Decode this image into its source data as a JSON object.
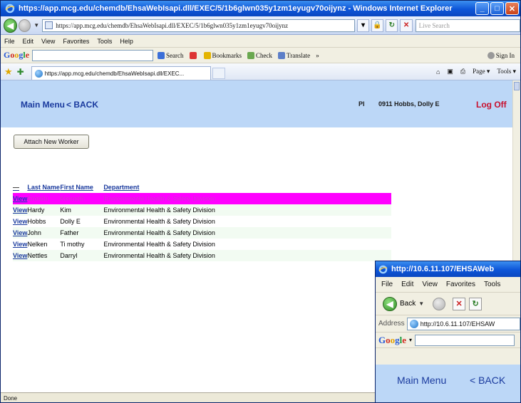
{
  "browser": {
    "title": "https://app.mcg.edu/chemdb/EhsaWebIsapi.dll/EXEC/5/1b6glwn035y1zm1eyugv70oijynz - Windows Internet Explorer",
    "url": "https://app.mcg.edu/chemdb/EhsaWebIsapi.dll/EXEC/5/1b6glwn035y1zm1eyugv70oijynz",
    "live_search_placeholder": "Live Search",
    "menu": [
      "File",
      "Edit",
      "View",
      "Favorites",
      "Tools",
      "Help"
    ],
    "google_toolbar": {
      "search": "Search",
      "bookmarks": "Bookmarks",
      "check": "Check",
      "translate": "Translate",
      "sign_in": "Sign In"
    },
    "tab_title": "https://app.mcg.edu/chemdb/EhsaWebIsapi.dll/EXEC...",
    "command_bar": {
      "page": "Page",
      "tools": "Tools"
    },
    "status": "Done"
  },
  "app": {
    "main_menu": "Main Menu",
    "back": "< BACK",
    "role": "PI",
    "user": "0911  Hobbs, Dolly E",
    "log_off": "Log Off",
    "attach_button": "Attach New Worker",
    "table": {
      "dash": "—",
      "headers": [
        "Last Name",
        "First Name",
        "Department"
      ],
      "view_label": "View",
      "rows": [
        {
          "last": "Erondu",
          "first": "Kenneth",
          "dept": "Environmental Health & Safety Division"
        },
        {
          "last": "Hardy",
          "first": "Kim",
          "dept": "Environmental Health & Safety Division"
        },
        {
          "last": "Hobbs",
          "first": "Dolly E",
          "dept": "Environmental Health & Safety Division"
        },
        {
          "last": "John",
          "first": "Father",
          "dept": "Environmental Health & Safety Division"
        },
        {
          "last": "Nelken",
          "first": "Ti mothy",
          "dept": "Environmental Health & Safety Division"
        },
        {
          "last": "Nettles",
          "first": "Darryl",
          "dept": "Environmental Health & Safety Division"
        }
      ]
    }
  },
  "second_window": {
    "title": "http://10.6.11.107/EHSAWeb",
    "menu": [
      "File",
      "Edit",
      "View",
      "Favorites",
      "Tools"
    ],
    "back_label": "Back",
    "address_label": "Address",
    "address": "http://10.6.11.107/EHSAW",
    "google": "Google",
    "main_menu": "Main Menu",
    "back": "< BACK"
  }
}
